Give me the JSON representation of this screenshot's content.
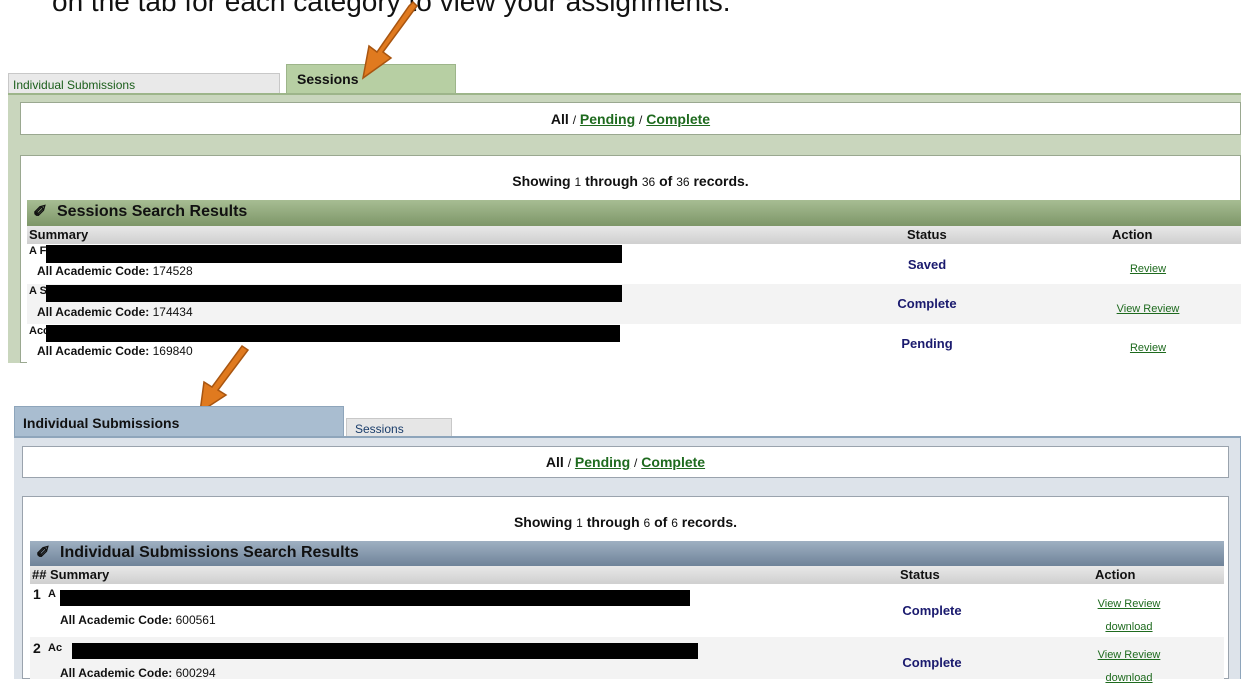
{
  "instruction": "on the tab for each category to view your assignments.",
  "top": {
    "tabs": [
      {
        "label": "Individual Submissions",
        "active": false
      },
      {
        "label": "Sessions",
        "active": true
      }
    ],
    "filter": {
      "all": "All",
      "sep": "/",
      "pending": "Pending",
      "complete": "Complete"
    },
    "showing": {
      "prefix": "Showing",
      "from": "1",
      "through": "through",
      "to": "36",
      "of": "of",
      "total": "36",
      "suffix": "records."
    },
    "results_title": "Sessions Search Results",
    "columns": {
      "summary": "Summary",
      "status": "Status",
      "action": "Action"
    },
    "rows": [
      {
        "title_prefix": "A Fr",
        "code_label": "All Academic Code:",
        "code": "174528",
        "status": "Saved",
        "actions": [
          "Review"
        ]
      },
      {
        "title_prefix": "A So",
        "code_label": "All Academic Code:",
        "code": "174434",
        "status": "Complete",
        "actions": [
          "View Review"
        ]
      },
      {
        "title_prefix": "Acce",
        "code_label": "All Academic Code:",
        "code": "169840",
        "status": "Pending",
        "actions": [
          "Review"
        ]
      }
    ]
  },
  "bottom": {
    "tabs": [
      {
        "label": "Individual Submissions",
        "active": true
      },
      {
        "label": "Sessions",
        "active": false
      }
    ],
    "filter": {
      "all": "All",
      "sep": "/",
      "pending": "Pending",
      "complete": "Complete"
    },
    "showing": {
      "prefix": "Showing",
      "from": "1",
      "through": "through",
      "to": "6",
      "of": "of",
      "total": "6",
      "suffix": "records."
    },
    "results_title": "Individual Submissions Search Results",
    "columns": {
      "num": "##",
      "summary": "Summary",
      "status": "Status",
      "action": "Action"
    },
    "rows": [
      {
        "num": "1",
        "title_prefix": "A",
        "code_label": "All Academic Code:",
        "code": "600561",
        "status": "Complete",
        "actions": [
          "View Review",
          "download"
        ]
      },
      {
        "num": "2",
        "title_prefix": "Ac",
        "code_label": "All Academic Code:",
        "code": "600294",
        "status": "Complete",
        "actions": [
          "View Review",
          "download"
        ]
      }
    ]
  },
  "colors": {
    "green_tab": "#b7cfa3",
    "green_header": "#8fa77c",
    "blue_tab": "#a9bdd0",
    "blue_header": "#7f93a8",
    "link_green": "#1e6a1e",
    "status_navy": "#1a1a6e",
    "arrow_orange": "#e07a1f"
  },
  "icons": [
    "pencil-check-icon",
    "arrow-pointer-icon"
  ]
}
